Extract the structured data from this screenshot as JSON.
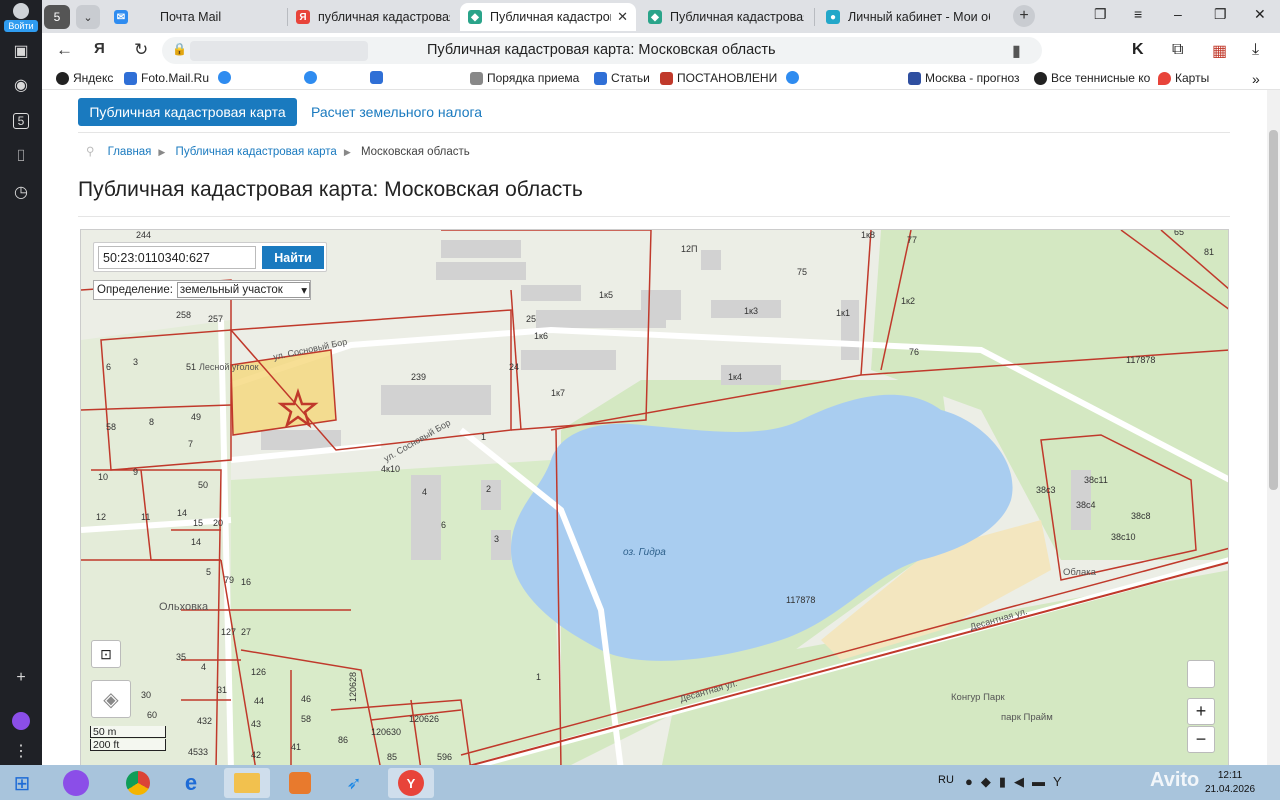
{
  "login_label": "Войти",
  "tabs": [
    {
      "label": "Почта Mail",
      "icon": "mail-icon",
      "color": "#2f8cf0"
    },
    {
      "label": "публичная кадастровая",
      "icon": "yandex-icon",
      "color": "#e8443a"
    },
    {
      "label": "Публичная кадастровая",
      "icon": "cadastre-icon",
      "color": "#2aa48a",
      "active": true
    },
    {
      "label": "Публичная кадастровая",
      "icon": "cadastre-icon",
      "color": "#2aa48a"
    },
    {
      "label": "Личный кабинет - Мои об",
      "icon": "cabinet-icon",
      "color": "#23a7c9"
    }
  ],
  "address": {
    "page_title": "Публичная кадастровая карта: Московская область"
  },
  "bookmarks": [
    "Яндекс",
    "Foto.Mail.Ru",
    "",
    "",
    "",
    "Порядка приема",
    "Статьи",
    "ПОСТАНОВЛЕНИ",
    "",
    "Москва - прогноз",
    "Все теннисные ко",
    "Карты"
  ],
  "nav": {
    "primary": "Публичная кадастровая карта",
    "secondary": "Расчет земельного налога"
  },
  "breadcrumbs": [
    "Главная",
    "Публичная кадастровая карта",
    "Московская область"
  ],
  "heading": "Публичная кадастровая карта: Московская область",
  "search": {
    "value": "50:23:0110340:627",
    "button": "Найти"
  },
  "definition": {
    "label": "Определение:",
    "value": "земельный участок"
  },
  "scale": {
    "metric": "50 m",
    "imperial": "200 ft"
  },
  "map_labels": {
    "lake": "оз. Гидра",
    "lake_parcel": "117878",
    "parcel_ne": "117878",
    "street1": "ул. Сосновый Бор",
    "street2": "ул. Сосновый Бор",
    "street3": "Десантная ул.",
    "street4": "Десантная ул.",
    "village": "Ольховка",
    "park1": "Конгур Парк",
    "park2": "парк Прайм",
    "oblaka": "Облака",
    "corner": "Лесной уголок",
    "parcels": [
      "244",
      "258",
      "257",
      "239",
      "75",
      "77",
      "76",
      "1к8",
      "12П",
      "1к5",
      "1к3",
      "1к1",
      "1к2",
      "1к6",
      "1к7",
      "1к4",
      "1",
      "2",
      "3",
      "4",
      "6",
      "4к10",
      "24",
      "25",
      "3",
      "6",
      "51",
      "49",
      "7",
      "58",
      "8",
      "10",
      "9",
      "12",
      "50",
      "14",
      "14",
      "15",
      "20",
      "11",
      "79",
      "16",
      "127",
      "27",
      "35",
      "30",
      "60",
      "31",
      "44",
      "432",
      "43",
      "42",
      "41",
      "46",
      "58",
      "86",
      "120628",
      "120630",
      "120626",
      "85",
      "596",
      "38с3",
      "38с11",
      "38с4",
      "38с8",
      "38с10",
      "65",
      "81",
      "4533",
      "4",
      "5",
      "2",
      "6",
      "126",
      "1"
    ]
  },
  "clock": {
    "time": "12:11",
    "date": "21.04.2026"
  },
  "lang": "RU",
  "watermark": "Avito",
  "colors": {
    "accent": "#1a7abf",
    "parcel_border": "#c0392b",
    "water": "#a9cdf0",
    "selected": "#f5d77a"
  }
}
